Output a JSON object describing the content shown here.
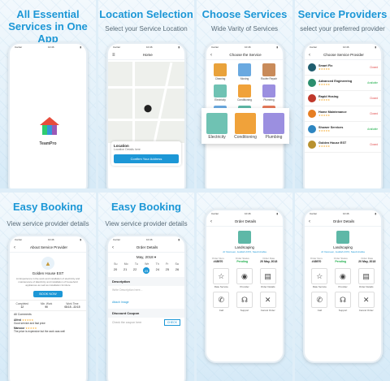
{
  "panels": [
    {
      "title": "All Essential Services in One App",
      "subtitle": ""
    },
    {
      "title": "Location Selection",
      "subtitle": "Select your Service Location"
    },
    {
      "title": "Choose Services",
      "subtitle": "Wide Varity of Services"
    },
    {
      "title": "Service Providers",
      "subtitle": "select your preferred provider"
    },
    {
      "title": "Easy Booking",
      "subtitle": "View service provider details"
    },
    {
      "title": "Easy Booking",
      "subtitle": "View service provider details"
    }
  ],
  "splash": {
    "app_name": "TeamPro"
  },
  "location": {
    "header_title": "Home",
    "card_title": "Location",
    "card_detail": "Location Details here",
    "confirm_button": "Confirm Your Address"
  },
  "services": {
    "header_title": "Choose the Service",
    "items": [
      {
        "label": "Cleaning",
        "color": "#e9a23b"
      },
      {
        "label": "Moving",
        "color": "#6aa9e0"
      },
      {
        "label": "Roofer Repair",
        "color": "#c98b5a"
      },
      {
        "label": "Electricity",
        "color": "#6fc2b3"
      },
      {
        "label": "Conditioning",
        "color": "#f0a23a"
      },
      {
        "label": "Plumbing",
        "color": "#9b8fe0"
      },
      {
        "label": "Satellite",
        "color": "#6aa9e0"
      },
      {
        "label": "Landscaping",
        "color": "#5eb8a7"
      },
      {
        "label": "General",
        "color": "#e57a5a"
      },
      {
        "label": "Locks",
        "color": "#6aa9e0"
      },
      {
        "label": "Windows",
        "color": "#e57a5a"
      },
      {
        "label": "Pest Control",
        "color": "#e9c25a"
      }
    ],
    "popout": [
      {
        "label": "Electricity",
        "color": "#6fc2b3"
      },
      {
        "label": "Conditioning",
        "color": "#f0a23a"
      },
      {
        "label": "Plumbing",
        "color": "#9b8fe0"
      }
    ]
  },
  "providers": {
    "header_title": "Choose Service Provider",
    "items": [
      {
        "name": "Smart Fix",
        "status": "Closed",
        "status_color": "#e04a4a",
        "color": "#1f5d6e"
      },
      {
        "name": "Advanced Engineering",
        "status": "Available",
        "status_color": "#1fae4b",
        "color": "#2c8f6e"
      },
      {
        "name": "Rapid Hosing",
        "status": "Closed",
        "status_color": "#e04a4a",
        "color": "#c0392b"
      },
      {
        "name": "Home Maintenance",
        "status": "Closed",
        "status_color": "#e04a4a",
        "color": "#e67e22"
      },
      {
        "name": "Shower Services",
        "status": "Available",
        "status_color": "#1fae4b",
        "color": "#2e86c1"
      },
      {
        "name": "Golden House EST",
        "status": "Closed",
        "status_color": "#e04a4a",
        "color": "#b8912f"
      }
    ],
    "stars": "★★★★★"
  },
  "about": {
    "header_title": "About Service Provider",
    "name": "Golden House EST",
    "description": "An Experience in the work and installation of electricity and maintenance of Electricity and installation of household appliances as well as installation furniture",
    "book_button": "BOOK NOW",
    "stats": [
      {
        "label": "Completed",
        "value": "12"
      },
      {
        "label": "Min. Work",
        "value": "90"
      },
      {
        "label": "Work Time",
        "value": "08:15 - 22:15"
      }
    ],
    "comments_title": "All Comments",
    "comments": [
      {
        "name": "Alfred",
        "text": "Good service and fast price"
      },
      {
        "name": "Mansour",
        "text": "The price is expensive but the work was well"
      }
    ]
  },
  "booking": {
    "header_title": "Order Details",
    "month": "May, 2018 ▾",
    "days": [
      "Su",
      "Mo",
      "Tu",
      "We",
      "Th",
      "Fr",
      "Sa"
    ],
    "dates": [
      "20",
      "21",
      "22",
      "23",
      "24",
      "25",
      "26"
    ],
    "selected_date": "23",
    "description_title": "Description",
    "description_placeholder": "Write Description here...",
    "attach": "Attach Image",
    "coupon_title": "Discount Coupon",
    "coupon_placeholder": "Check the coupon here",
    "check_button": "CHECK"
  },
  "order": {
    "header_title": "Order Details",
    "service": "Landscaping",
    "address": "Al Yasmeen, Jeddah 2372, Saudi Arabia",
    "meta": [
      {
        "label": "Order Num.",
        "value": "#48970"
      },
      {
        "label": "Order Status",
        "value": "Pending"
      },
      {
        "label": "Order Date",
        "value": "20 May, 2018"
      }
    ],
    "actions": [
      {
        "label": "Rate Service",
        "glyph": "☆"
      },
      {
        "label": "Provider",
        "glyph": "◉"
      },
      {
        "label": "Order Details",
        "glyph": "▤"
      },
      {
        "label": "Call",
        "glyph": "✆"
      },
      {
        "label": "Support",
        "glyph": "☊"
      },
      {
        "label": "Cancel Order",
        "glyph": "✕"
      }
    ]
  },
  "status_bar": {
    "carrier": "Carrier",
    "time": "10:46"
  }
}
